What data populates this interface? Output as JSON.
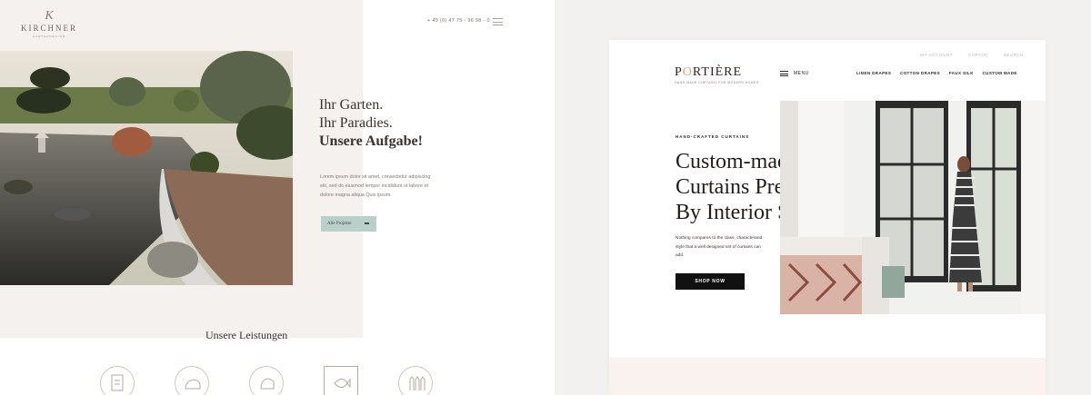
{
  "left_site": {
    "logo": {
      "mark": "K",
      "name": "KIRCHNER",
      "tagline": "GARTENDESIGN"
    },
    "phone": "+ 49 (0) 47 75 - 96 98 - 0",
    "heading": {
      "line1": "Ihr Garten.",
      "line2": "Ihr Paradies.",
      "line3": "Unsere Aufgabe!"
    },
    "lorem": "Lorem ipsum dolor sit amet, consectetur adipiscing elit, sed do eiusmod tempor incididunt ut labore et dolore magna aliqua Quis ipsum.",
    "cta_label": "Alle Projekte",
    "services_title": "Unsere Leistungen",
    "service_icons": [
      "plan-icon",
      "hedge-icon",
      "bush-icon",
      "fish-icon",
      "fence-icon"
    ],
    "colors": {
      "beige": "#f5f1ee",
      "button": "#b9cfca"
    }
  },
  "right_site": {
    "toplinks": [
      "MY ACCOUNT",
      "CART(0)",
      "SEARCH"
    ],
    "logo": {
      "name_prefix": "P",
      "name_highlight": "O",
      "name_suffix": "RTIÈRE",
      "tagline": "HAND-MADE CURTAINS FOR MODERN HOMES"
    },
    "menu_label": "MENU",
    "nav": [
      "LINEN DRAPES",
      "COTTON DRAPES",
      "FAUX SILK",
      "CUSTOM MADE"
    ],
    "eyebrow": "HAND-CRAFTED CURTAINS",
    "headline": "Custom-made Curtains Preferred By Interior Stylists",
    "description": "Nothing compares to the class, characterand style that a well designed set of curtains can add.",
    "shop_label": "SHOP NOW",
    "colors": {
      "accent": "#d7a38b",
      "button": "#111111"
    }
  }
}
